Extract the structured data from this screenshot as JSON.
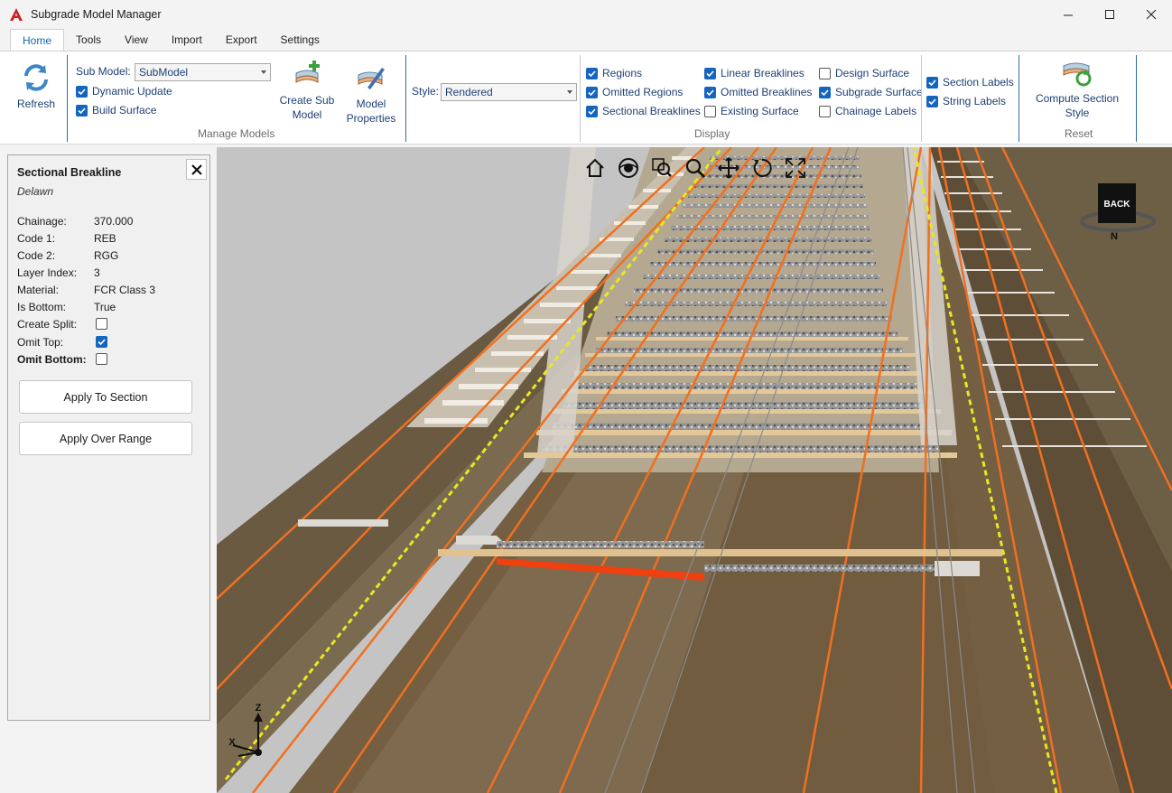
{
  "window": {
    "title": "Subgrade Model Manager"
  },
  "tabs": [
    {
      "label": "Home",
      "active": true
    },
    {
      "label": "Tools"
    },
    {
      "label": "View"
    },
    {
      "label": "Import"
    },
    {
      "label": "Export"
    },
    {
      "label": "Settings"
    }
  ],
  "ribbon": {
    "refresh_label": "Refresh",
    "sub_model_label": "Sub Model:",
    "sub_model_value": "SubModel",
    "dynamic_update": {
      "label": "Dynamic Update",
      "checked": true
    },
    "build_surface": {
      "label": "Build Surface",
      "checked": true
    },
    "create_sub_model": [
      "Create Sub",
      "Model"
    ],
    "model_properties": [
      "Model",
      "Properties"
    ],
    "manage_models_label": "Manage Models",
    "style_label": "Style:",
    "style_value": "Rendered",
    "display_label": "Display",
    "display": {
      "regions": {
        "label": "Regions",
        "checked": true
      },
      "omitted_regions": {
        "label": "Omitted Regions",
        "checked": true
      },
      "sectional_breaklines": {
        "label": "Sectional Breaklines",
        "checked": true
      },
      "linear_breaklines": {
        "label": "Linear Breaklines",
        "checked": true
      },
      "omitted_breaklines": {
        "label": "Omitted Breaklines",
        "checked": true
      },
      "existing_surface": {
        "label": "Existing Surface",
        "checked": false
      },
      "design_surface": {
        "label": "Design Surface",
        "checked": false
      },
      "subgrade_surface": {
        "label": "Subgrade Surface",
        "checked": true
      },
      "chainage_labels": {
        "label": "Chainage Labels",
        "checked": false
      },
      "section_labels": {
        "label": "Section Labels",
        "checked": true
      },
      "string_labels": {
        "label": "String Labels",
        "checked": true
      }
    },
    "compute_section_style": [
      "Compute Section",
      "Style"
    ],
    "reset_label": "Reset"
  },
  "panel": {
    "title": "Sectional Breakline",
    "subtitle": "Delawn",
    "properties": [
      {
        "label": "Chainage:",
        "value": "370.000"
      },
      {
        "label": "Code 1:",
        "value": "REB"
      },
      {
        "label": "Code 2:",
        "value": "RGG"
      },
      {
        "label": "Layer Index:",
        "value": "3"
      },
      {
        "label": "Material:",
        "value": "FCR Class 3"
      },
      {
        "label": "Is Bottom:",
        "value": "True"
      }
    ],
    "create_split": {
      "label": "Create Split:",
      "checked": false
    },
    "omit_top": {
      "label": "Omit Top:",
      "checked": true
    },
    "omit_bottom": {
      "label": "Omit Bottom:",
      "checked": false
    },
    "apply_to_section": "Apply To Section",
    "apply_over_range": "Apply Over Range"
  },
  "viewport": {
    "viewcube_face": "BACK",
    "compass_north": "N",
    "axis_z": "Z",
    "axis_x": "X"
  },
  "colors": {
    "accent": "#1565c0",
    "ribbon_separator": "#2f6aa8",
    "highlight_orange": "#f07020",
    "selected_breakline": "#f04010",
    "yellow_line": "#e8e820",
    "ground": "#6b5a40"
  }
}
